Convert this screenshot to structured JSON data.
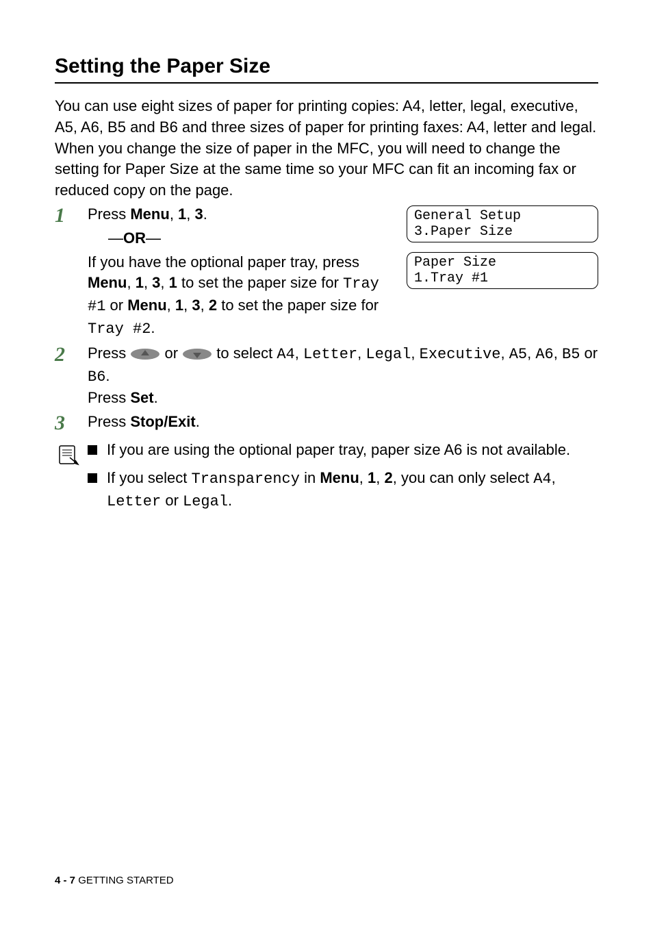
{
  "heading": "Setting the Paper Size",
  "intro": "You can use eight sizes of paper for printing copies: A4, letter, legal, executive, A5, A6, B5 and B6 and three sizes of paper for printing faxes: A4, letter and legal. When you change the size of paper in the MFC, you will need to change the setting for Paper Size at the same time so your MFC can fit an incoming fax or reduced copy on the page.",
  "step1": {
    "num": "1",
    "press": "Press ",
    "menu": "Menu",
    "comma1": ", ",
    "one": "1",
    "comma2": ", ",
    "three": "3",
    "period": ".",
    "or": "OR",
    "dash": "—",
    "line2a": "If you have the optional paper tray, press ",
    "line2b": " to set the paper size for ",
    "tray1": "Tray #1",
    "line2c": " or ",
    "two": "2",
    "line2d": " to set the paper size for ",
    "tray2": "Tray #2",
    "comma3": ", "
  },
  "lcd1_line1": "General Setup",
  "lcd1_line2": "3.Paper Size",
  "lcd2_line1": "Paper Size",
  "lcd2_line2": "1.Tray #1",
  "step2": {
    "num": "2",
    "press": "Press ",
    "or": " or ",
    "toselect": " to select ",
    "options": {
      "a4": "A4",
      "letter": "Letter",
      "legal": "Legal",
      "executive": "Executive",
      "a5": "A5",
      "a6": "A6",
      "b5": "B5",
      "b6": "B6"
    },
    "orword": " or ",
    "period": ".",
    "press_set": "Press ",
    "set": "Set"
  },
  "step3": {
    "num": "3",
    "press": "Press ",
    "stopexit": "Stop/Exit",
    "period": "."
  },
  "notes": {
    "n1": "If you are using the optional paper tray, paper size A6 is not available.",
    "n2a": "If you select ",
    "transparency": "Transparency",
    "n2b": " in ",
    "menu": "Menu",
    "comma1": ", ",
    "one": "1",
    "comma2": ", ",
    "two": "2",
    "n2c": ", you can only select ",
    "a4": "A4",
    "n2d": ", ",
    "letter": "Letter",
    "orword": " or ",
    "legal": "Legal",
    "period": "."
  },
  "footer": {
    "page": "4 - 7",
    "sep": "   ",
    "label": "GETTING STARTED"
  }
}
